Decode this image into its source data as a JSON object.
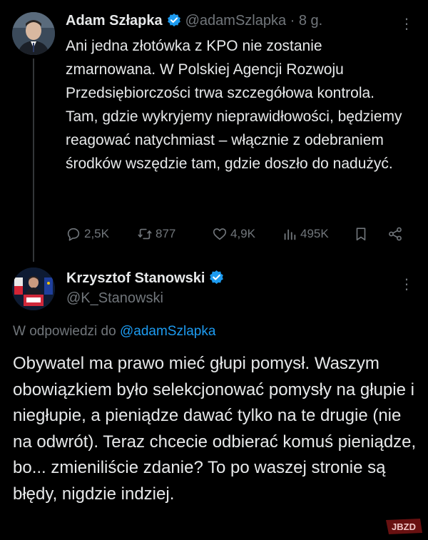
{
  "tweet1": {
    "author_name": "Adam Szłapka",
    "author_handle": "@adamSzlapka",
    "time": "· 8 g.",
    "text": "Ani jedna złotówka z KPO nie zostanie zmarnowana. W Polskiej Agencji Rozwoju Przedsiębiorczości trwa szczegółowa kontrola. Tam, gdzie wykryjemy nieprawidłowości, będziemy reagować natychmiast – włącznie z odebraniem środków wszędzie tam, gdzie doszło do nadużyć.",
    "actions": {
      "replies": "2,5K",
      "reposts": "877",
      "likes": "4,9K",
      "views": "495K"
    }
  },
  "tweet2": {
    "author_name": "Krzysztof Stanowski",
    "author_handle": "@K_Stanowski",
    "reply_prefix": "W odpowiedzi do",
    "reply_to": "@adamSzlapka",
    "text": "Obywatel ma prawo mieć głupi pomysł. Waszym obowiązkiem było selekcjonować pomysły na głupie i niegłupie, a pieniądze dawać tylko na te drugie (nie na odwrót). Teraz chcecie odbierać komuś pieniądze, bo... zmieniliście zdanie? To po waszej stronie są błędy, nigdzie indziej."
  },
  "watermark": "JBZD",
  "colors": {
    "background": "#000000",
    "text": "#e7e9ea",
    "secondary": "#71767b",
    "accent": "#1d9bf0"
  }
}
